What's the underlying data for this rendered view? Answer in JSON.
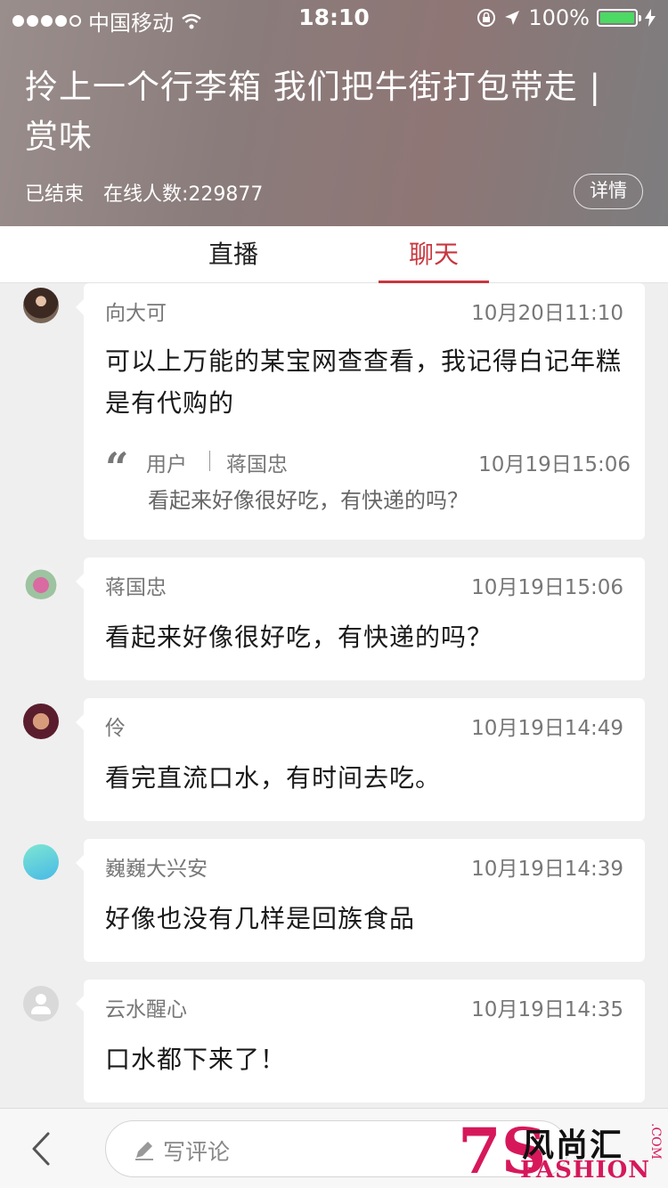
{
  "status_bar": {
    "carrier": "中国移动",
    "time": "18:10",
    "battery": "100%"
  },
  "header": {
    "title": "拎上一个行李箱 我们把牛街打包带走 | 赏味",
    "status": "已结束",
    "online_count": "在线人数:229877",
    "detail_button": "详情"
  },
  "tabs": [
    {
      "label": "直播",
      "active": false
    },
    {
      "label": "聊天",
      "active": true
    }
  ],
  "messages": [
    {
      "name": "向大可",
      "time": "10月20日11:10",
      "text": "可以上万能的某宝网查查看，我记得白记年糕是有代购的",
      "quote": {
        "label": "用户",
        "name": "蒋国忠",
        "time": "10月19日15:06",
        "text": "看起来好像很好吃，有快递的吗？"
      }
    },
    {
      "name": "蒋国忠",
      "time": "10月19日15:06",
      "text": "看起来好像很好吃，有快递的吗？"
    },
    {
      "name": "伶",
      "time": "10月19日14:49",
      "text": "看完直流口水，有时间去吃。"
    },
    {
      "name": "巍巍大兴安",
      "time": "10月19日14:39",
      "text": "好像也没有几样是回族食品"
    },
    {
      "name": "云水醒心",
      "time": "10月19日14:35",
      "text": "口水都下来了！"
    }
  ],
  "bottom_bar": {
    "comment_placeholder": "写评论",
    "watermark_cn": "风尚汇",
    "watermark_en": "FASHION",
    "watermark_num": "7S",
    "watermark_com": ".COM"
  },
  "colors": {
    "accent": "#c8373f",
    "battery": "#4cd964"
  }
}
